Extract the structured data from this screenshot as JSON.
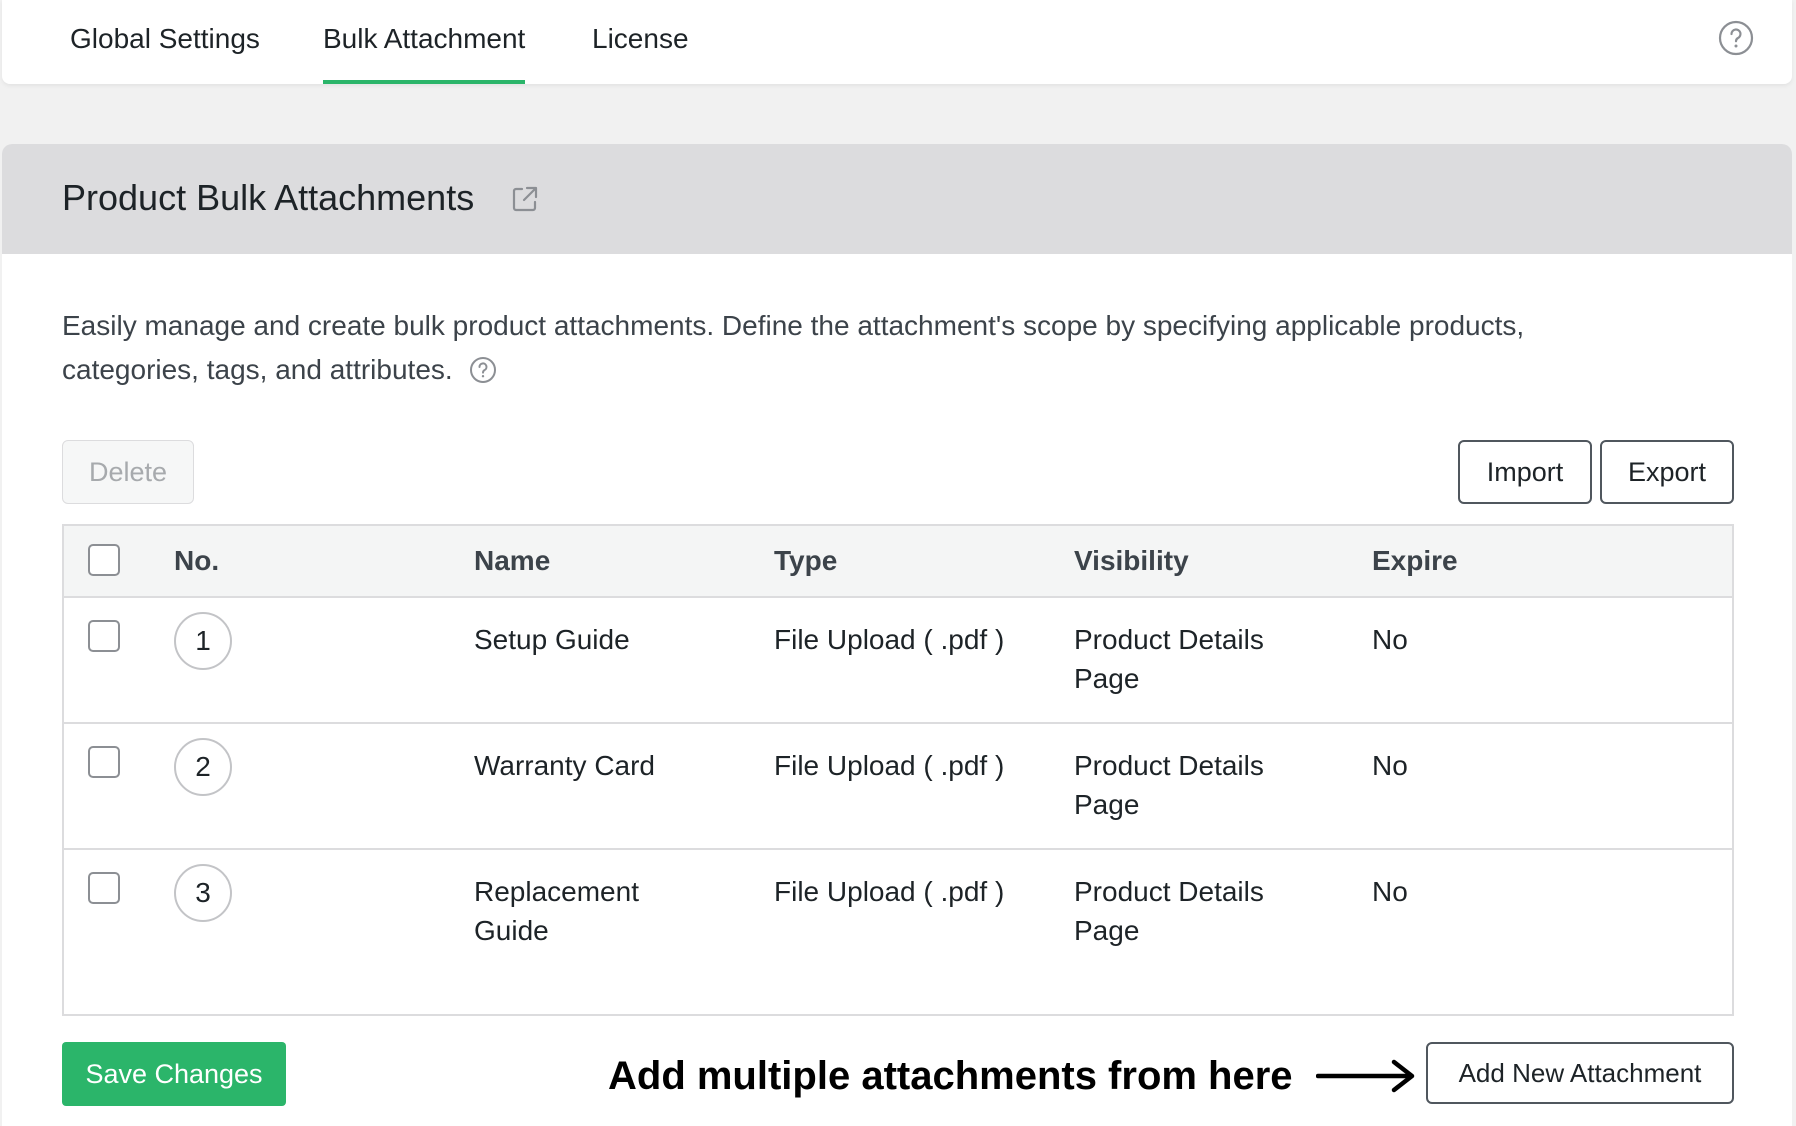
{
  "tabs": [
    {
      "label": "Global Settings",
      "active": false
    },
    {
      "label": "Bulk Attachment",
      "active": true
    },
    {
      "label": "License",
      "active": false
    }
  ],
  "header": {
    "title": "Product Bulk Attachments",
    "description": "Easily manage and create bulk product attachments. Define the attachment's scope by specifying applicable products, categories, tags, and attributes."
  },
  "toolbar": {
    "delete_label": "Delete",
    "import_label": "Import",
    "export_label": "Export"
  },
  "table": {
    "columns": [
      "No.",
      "Name",
      "Type",
      "Visibility",
      "Expire"
    ],
    "rows": [
      {
        "no": "1",
        "name": "Setup Guide",
        "type": "File Upload ( .pdf )",
        "visibility": "Product Details Page",
        "expire": "No"
      },
      {
        "no": "2",
        "name": "Warranty Card",
        "type": "File Upload ( .pdf )",
        "visibility": "Product Details Page",
        "expire": "No"
      },
      {
        "no": "3",
        "name": "Replacement Guide",
        "type": "File Upload ( .pdf )",
        "visibility": "Product Details Page",
        "expire": "No"
      }
    ]
  },
  "footer": {
    "save_label": "Save Changes",
    "annotation": "Add multiple attachments from here",
    "add_label": "Add New Attachment"
  },
  "colors": {
    "accent": "#2bb56a",
    "header_bg": "#dcdcde",
    "page_bg": "#f1f1f1"
  },
  "icons": {
    "help": "help-circle-icon",
    "external": "external-link-icon",
    "arrow": "arrow-right-icon"
  }
}
